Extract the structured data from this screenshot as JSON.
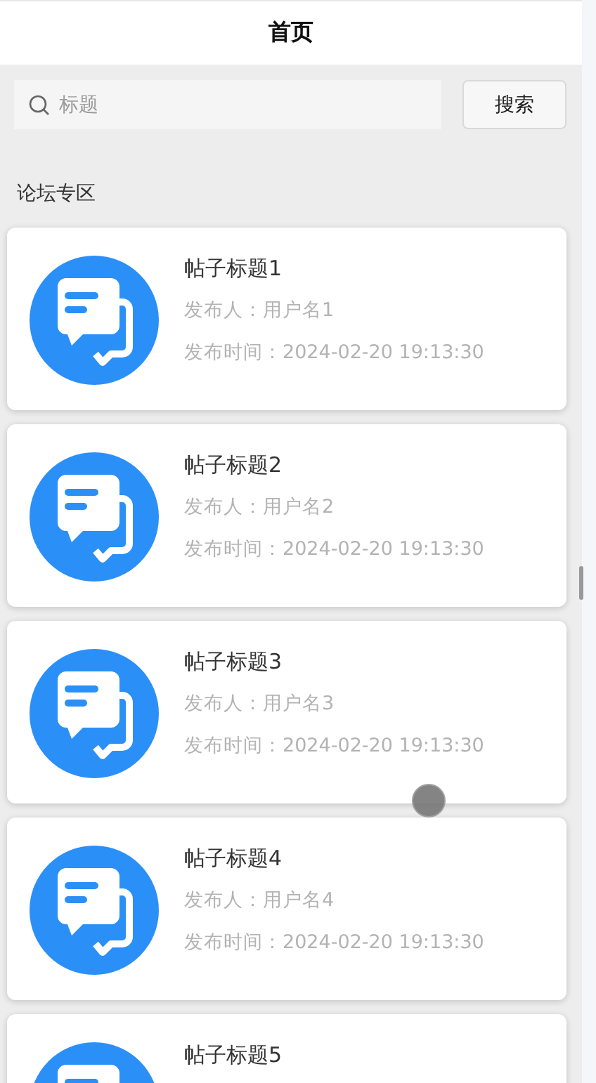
{
  "header": {
    "title": "首页"
  },
  "search": {
    "placeholder": "标题",
    "button": "搜索"
  },
  "section": {
    "title": "论坛专区"
  },
  "posts": [
    {
      "title": "帖子标题1",
      "author": "发布人：用户名1",
      "time": "发布时间：2024-02-20 19:13:30"
    },
    {
      "title": "帖子标题2",
      "author": "发布人：用户名2",
      "time": "发布时间：2024-02-20 19:13:30"
    },
    {
      "title": "帖子标题3",
      "author": "发布人：用户名3",
      "time": "发布时间：2024-02-20 19:13:30"
    },
    {
      "title": "帖子标题4",
      "author": "发布人：用户名4",
      "time": "发布时间：2024-02-20 19:13:30"
    },
    {
      "title": "帖子标题5"
    }
  ]
}
